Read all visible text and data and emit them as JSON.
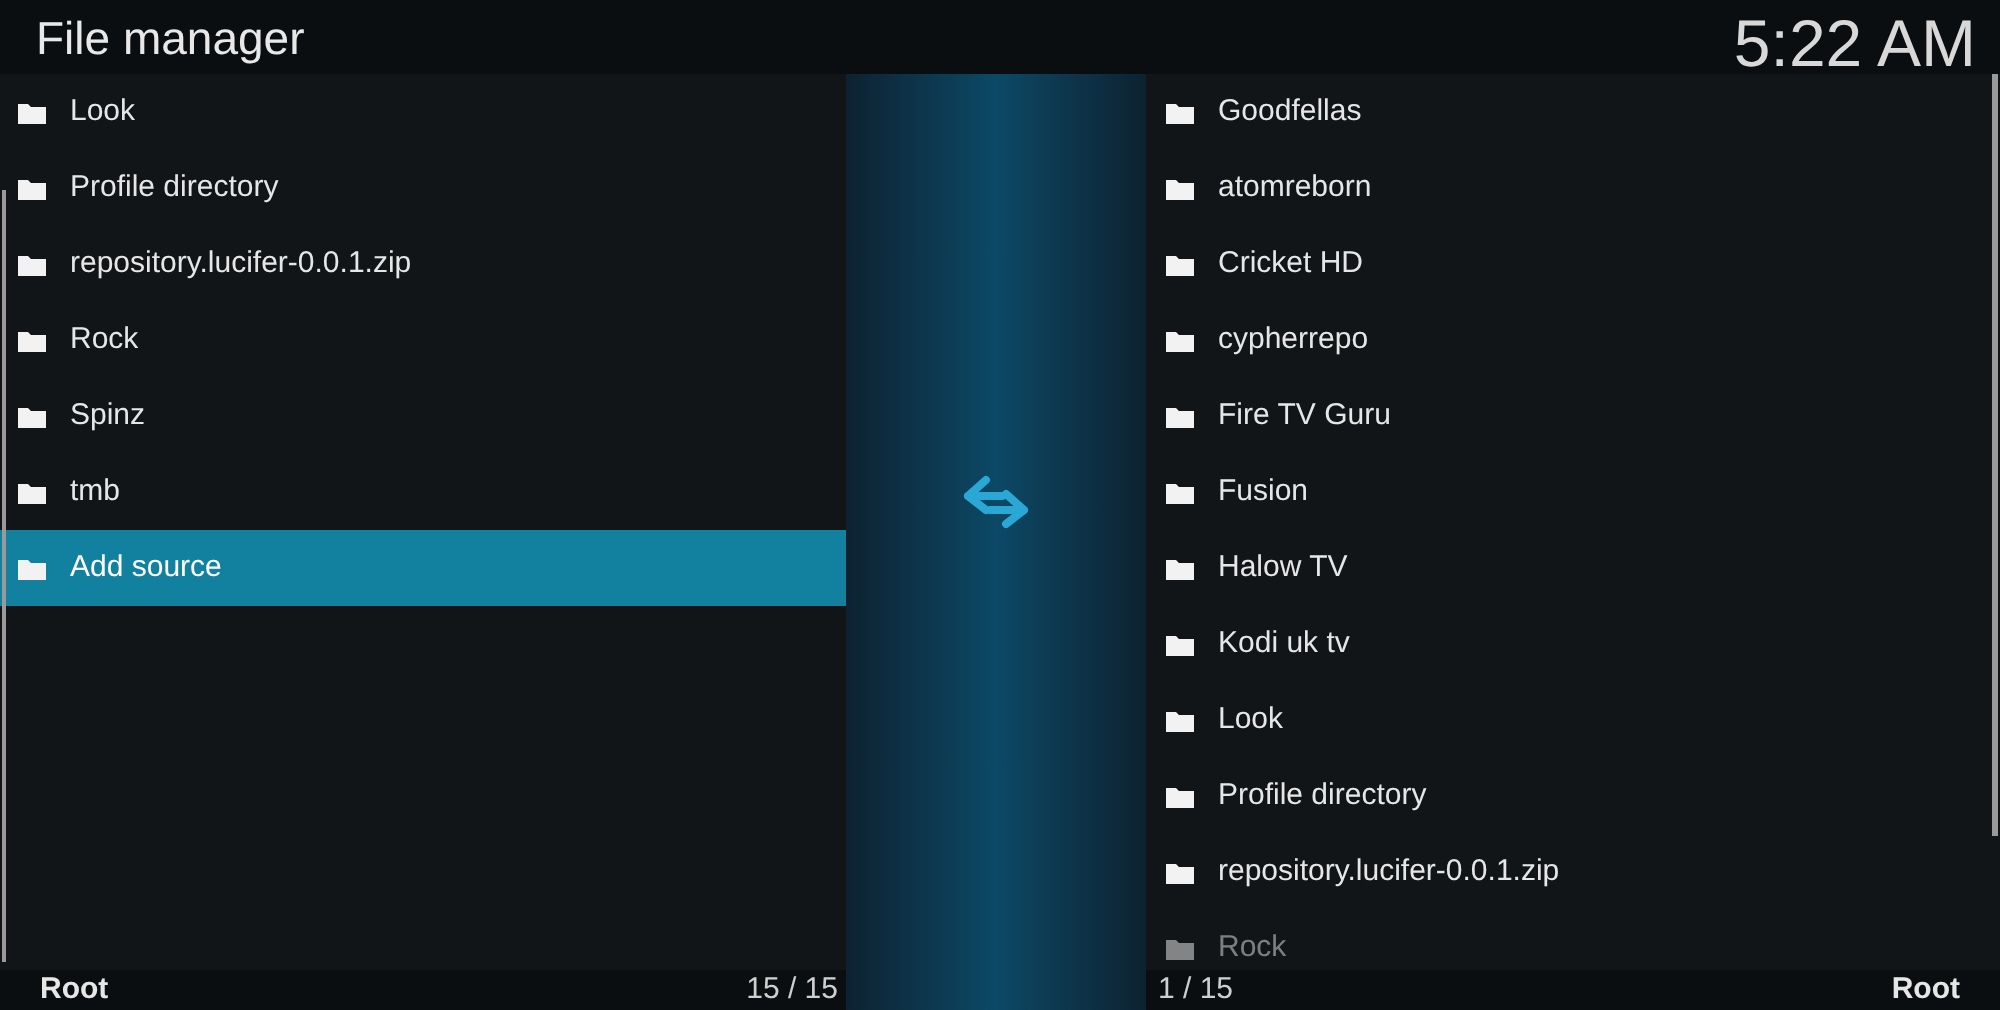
{
  "window": {
    "title": "File manager",
    "clock": "5:22 AM"
  },
  "left_pane": {
    "items": [
      {
        "label": "Look",
        "selected": false
      },
      {
        "label": "Profile directory",
        "selected": false
      },
      {
        "label": "repository.lucifer-0.0.1.zip",
        "selected": false
      },
      {
        "label": "Rock",
        "selected": false
      },
      {
        "label": "Spinz",
        "selected": false
      },
      {
        "label": "tmb",
        "selected": false
      },
      {
        "label": "Add source",
        "selected": true
      }
    ],
    "footer": {
      "path": "Root",
      "count": "15 / 15"
    }
  },
  "right_pane": {
    "items": [
      {
        "label": "Goodfellas",
        "selected": false,
        "dimmed": false
      },
      {
        "label": "atomreborn",
        "selected": false,
        "dimmed": false
      },
      {
        "label": "Cricket HD",
        "selected": false,
        "dimmed": false
      },
      {
        "label": "cypherrepo",
        "selected": false,
        "dimmed": false
      },
      {
        "label": "Fire TV Guru",
        "selected": false,
        "dimmed": false
      },
      {
        "label": "Fusion",
        "selected": false,
        "dimmed": false
      },
      {
        "label": "Halow TV",
        "selected": false,
        "dimmed": false
      },
      {
        "label": "Kodi uk tv",
        "selected": false,
        "dimmed": false
      },
      {
        "label": "Look",
        "selected": false,
        "dimmed": false
      },
      {
        "label": "Profile directory",
        "selected": false,
        "dimmed": false
      },
      {
        "label": "repository.lucifer-0.0.1.zip",
        "selected": false,
        "dimmed": false
      },
      {
        "label": "Rock",
        "selected": false,
        "dimmed": true
      }
    ],
    "footer": {
      "count": "1 / 15",
      "path": "Root"
    }
  }
}
